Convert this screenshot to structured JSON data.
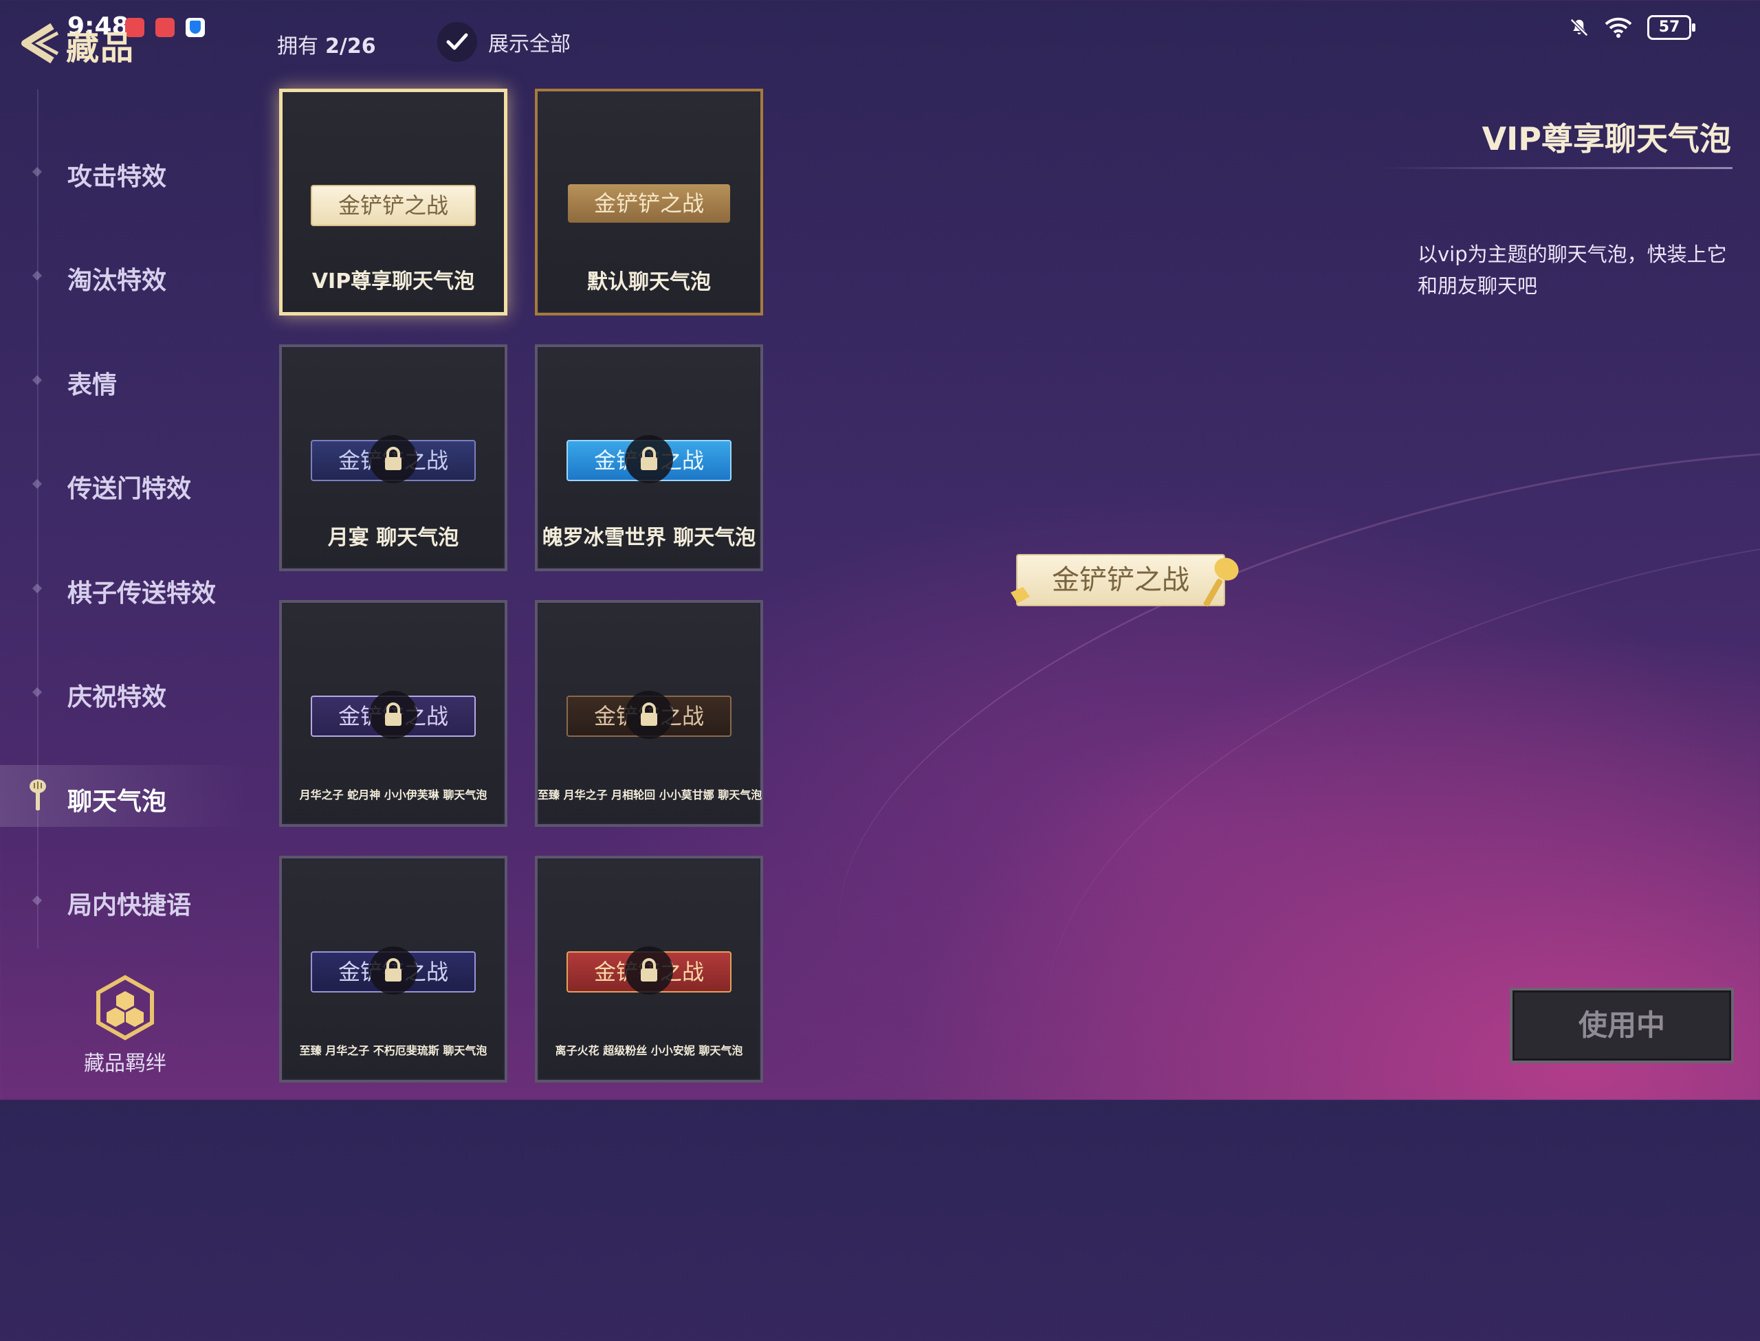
{
  "status_bar": {
    "time": "9:48",
    "battery": "57"
  },
  "header": {
    "title": "藏品",
    "owned_label": "拥有",
    "owned_count": "2/26",
    "show_all_label": "展示全部"
  },
  "sidebar": {
    "items": [
      {
        "label": "攻击特效",
        "active": false
      },
      {
        "label": "淘汰特效",
        "active": false
      },
      {
        "label": "表情",
        "active": false
      },
      {
        "label": "传送门特效",
        "active": false
      },
      {
        "label": "棋子传送特效",
        "active": false
      },
      {
        "label": "庆祝特效",
        "active": false
      },
      {
        "label": "聊天气泡",
        "active": true
      },
      {
        "label": "局内快捷语",
        "active": false
      }
    ],
    "bond_label": "藏品羁绊"
  },
  "grid": {
    "items": [
      {
        "name": "VIP尊享聊天气泡",
        "bubble_text": "金铲铲之战",
        "locked": false,
        "selected": true
      },
      {
        "name": "默认聊天气泡",
        "bubble_text": "金铲铲之战",
        "locked": false,
        "selected": false
      },
      {
        "name": "月宴 聊天气泡",
        "bubble_text": "金铲铲之战",
        "locked": true
      },
      {
        "name": "魄罗冰雪世界 聊天气泡",
        "bubble_text": "金铲铲之战",
        "locked": true
      },
      {
        "name": "月华之子 蛇月神 小小伊芙琳 聊天气泡",
        "bubble_text": "金铲铲之战",
        "locked": true
      },
      {
        "name": "至臻 月华之子 月相轮回 小小莫甘娜 聊天气泡",
        "bubble_text": "金铲铲之战",
        "locked": true
      },
      {
        "name": "至臻 月华之子 不朽厄斐琉斯 聊天气泡",
        "bubble_text": "金铲铲之战",
        "locked": true
      },
      {
        "name": "离子火花 超级粉丝 小小安妮 聊天气泡",
        "bubble_text": "金铲铲之战",
        "locked": true
      }
    ]
  },
  "detail": {
    "title": "VIP尊享聊天气泡",
    "description": "以vip为主题的聊天气泡，快装上它和朋友聊天吧",
    "preview_text": "金铲铲之战",
    "button_label": "使用中"
  },
  "colors": {
    "accent_gold": "#f1dfa4",
    "background": "#3d2a66"
  }
}
